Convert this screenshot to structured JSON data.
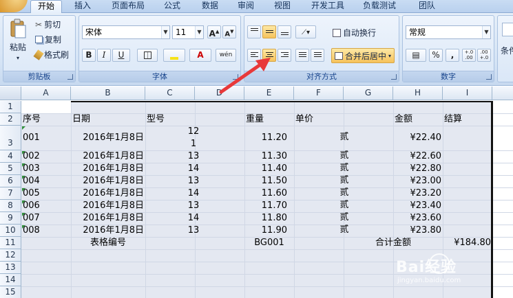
{
  "tabs": [
    "开始",
    "插入",
    "页面布局",
    "公式",
    "数据",
    "审阅",
    "视图",
    "开发工具",
    "负载测试",
    "团队"
  ],
  "clipboard": {
    "paste": "粘贴",
    "cut": "剪切",
    "copy": "复制",
    "format_painter": "格式刷",
    "label": "剪贴板"
  },
  "font": {
    "name": "宋体",
    "size": "11",
    "grow": "A",
    "shrink": "A",
    "bold": "B",
    "italic": "I",
    "underline": "U",
    "font_color_glyph": "A",
    "phonetic": "wén",
    "label": "字体"
  },
  "alignment": {
    "wrap_text": "自动换行",
    "merge_center": "合并后居中",
    "label": "对齐方式"
  },
  "number": {
    "format": "常规",
    "percent": "%",
    "comma": ",",
    "inc_decimal": "+.0 .00",
    "dec_decimal": ".00 +.0",
    "label": "数字"
  },
  "styles": {
    "cond_label": "条件"
  },
  "columns": [
    "A",
    "B",
    "C",
    "D",
    "E",
    "F",
    "G",
    "H",
    "I"
  ],
  "rows": [
    "1",
    "2",
    "3",
    "4",
    "5",
    "6",
    "7",
    "8",
    "9",
    "10",
    "11",
    "12",
    "13",
    "14",
    "15"
  ],
  "table": {
    "headers": {
      "seq": "序号",
      "date": "日期",
      "model": "型号",
      "weight": "重量",
      "price": "单价",
      "amount": "金额",
      "settle": "结算"
    },
    "row3_model_top": "12",
    "row3_model_bottom": "1",
    "records": [
      {
        "seq": "001",
        "date": "2016年1月8日",
        "model": "",
        "weight": "11.20",
        "price": "贰",
        "amount": "¥22.40"
      },
      {
        "seq": "002",
        "date": "2016年1月8日",
        "model": "13",
        "weight": "11.30",
        "price": "贰",
        "amount": "¥22.60"
      },
      {
        "seq": "003",
        "date": "2016年1月8日",
        "model": "14",
        "weight": "11.40",
        "price": "贰",
        "amount": "¥22.80"
      },
      {
        "seq": "004",
        "date": "2016年1月8日",
        "model": "13",
        "weight": "11.50",
        "price": "贰",
        "amount": "¥23.00"
      },
      {
        "seq": "005",
        "date": "2016年1月8日",
        "model": "14",
        "weight": "11.60",
        "price": "贰",
        "amount": "¥23.20"
      },
      {
        "seq": "006",
        "date": "2016年1月8日",
        "model": "13",
        "weight": "11.70",
        "price": "贰",
        "amount": "¥23.40"
      },
      {
        "seq": "007",
        "date": "2016年1月8日",
        "model": "14",
        "weight": "11.80",
        "price": "贰",
        "amount": "¥23.60"
      },
      {
        "seq": "008",
        "date": "2016年1月8日",
        "model": "13",
        "weight": "11.90",
        "price": "贰",
        "amount": "¥23.80"
      }
    ],
    "footer": {
      "table_no_label": "表格编号",
      "table_no": "BG001",
      "total_label": "合计金额",
      "total": "¥184.80"
    }
  },
  "watermark": {
    "text": "Bai经验",
    "url": "jingyan.baidu.com"
  },
  "colors": {
    "accent": "#f6c25b",
    "arrow": "#e8393a",
    "grid_fill": "#e4e8f1"
  }
}
